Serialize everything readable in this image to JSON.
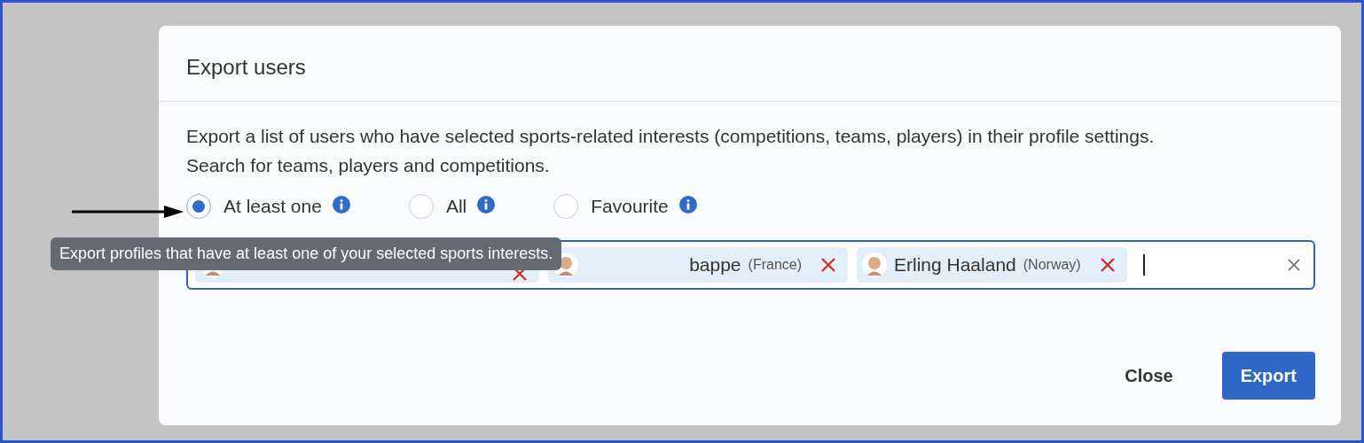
{
  "dialog": {
    "title": "Export users",
    "description": "Export a list of users who have selected sports-related interests (competitions, teams, players) in their profile settings. Search for teams, players and competitions.",
    "options": [
      {
        "label": "At least one",
        "selected": true
      },
      {
        "label": "All",
        "selected": false
      },
      {
        "label": "Favourite",
        "selected": false
      }
    ],
    "tooltip": "Export profiles that have at least one of your selected sports interests.",
    "chips": [
      {
        "covered": true
      },
      {
        "covered": true,
        "name": "bappe",
        "detail": "(France)"
      },
      {
        "name": "Erling Haaland",
        "detail": "(Norway)"
      }
    ],
    "buttons": [
      {
        "label": "Close",
        "kind": "secondary"
      },
      {
        "label": "Export",
        "kind": "primary"
      }
    ]
  }
}
